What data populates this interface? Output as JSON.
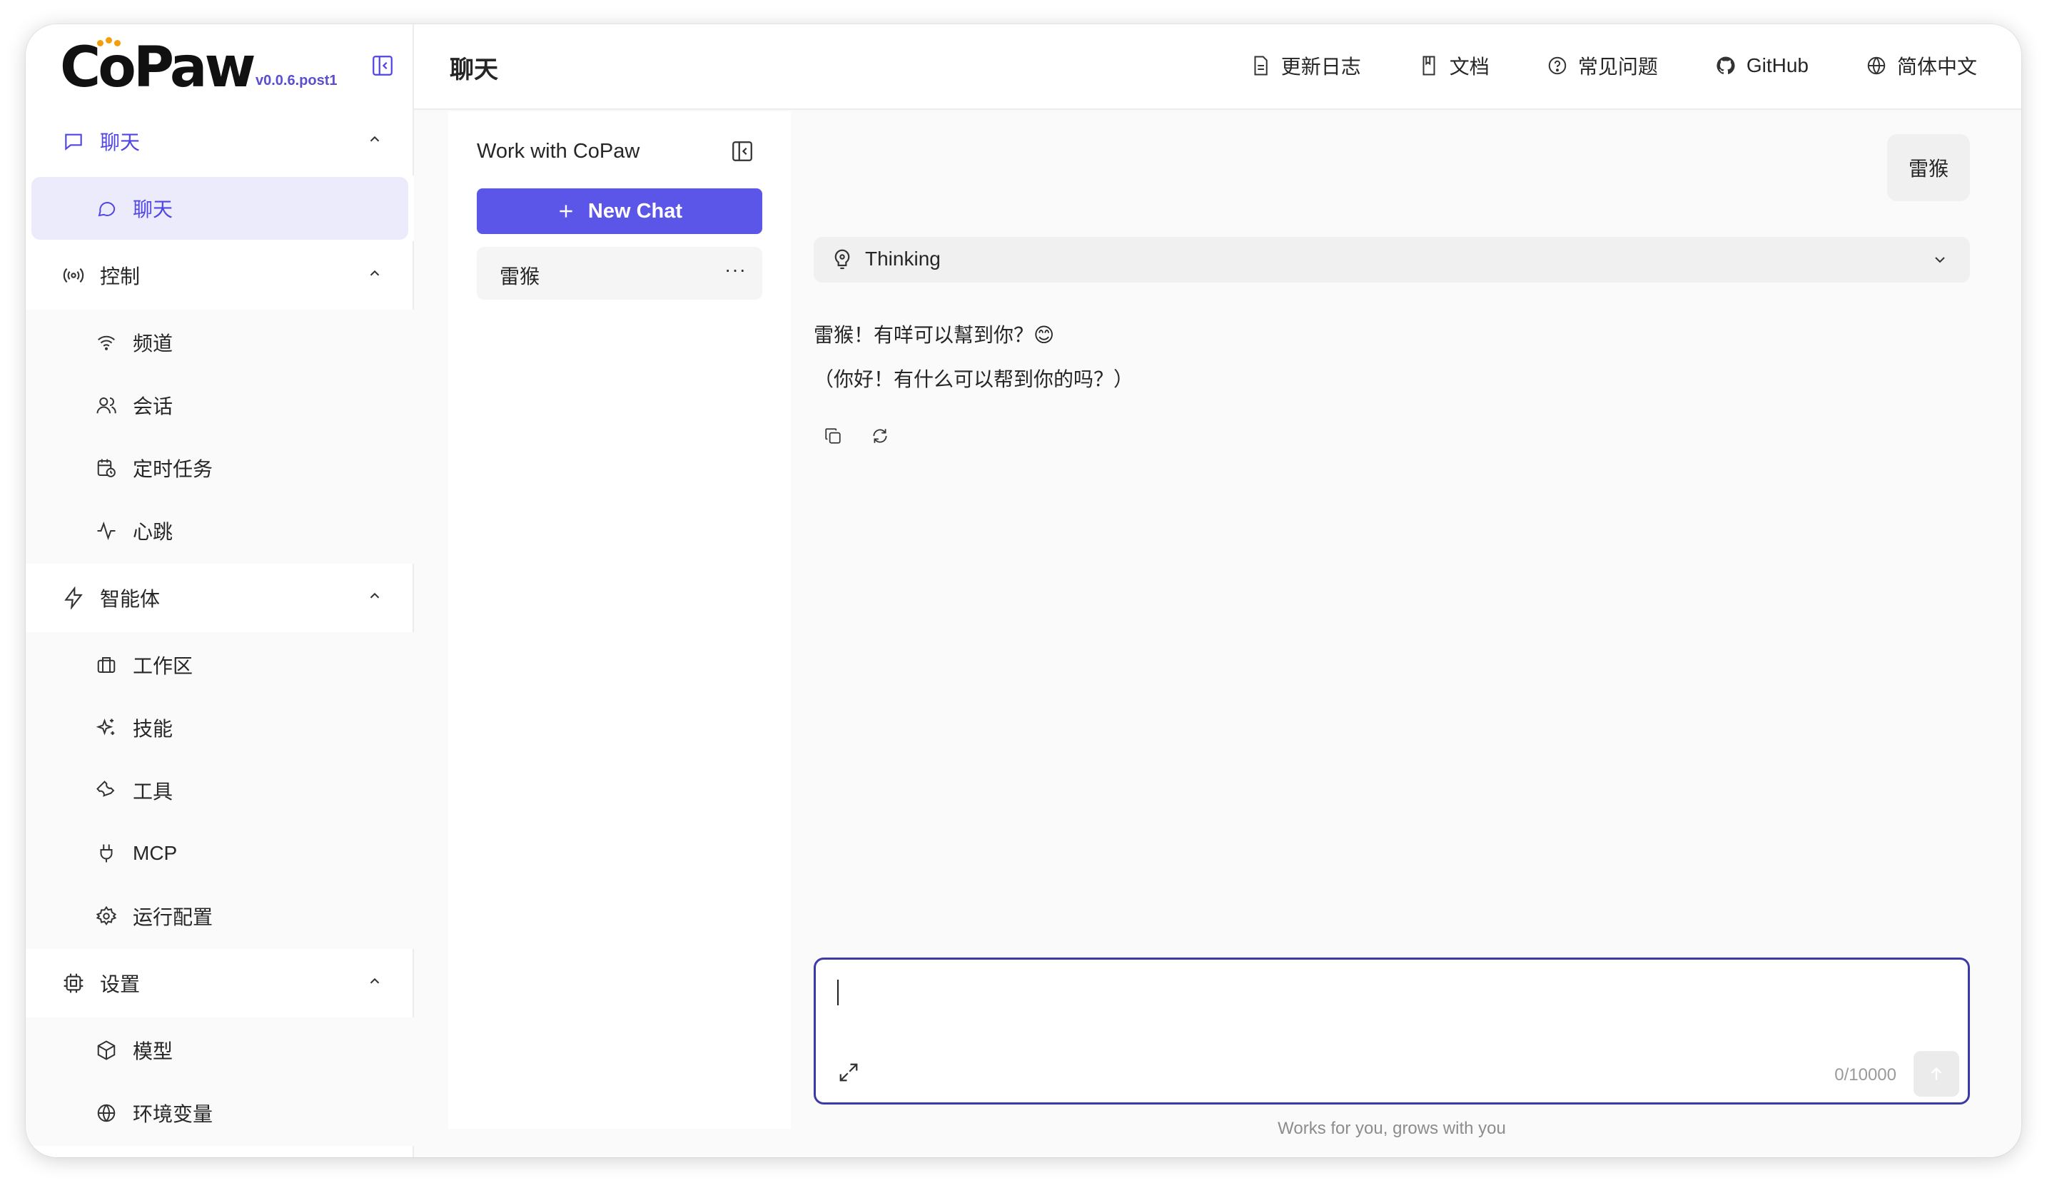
{
  "app": {
    "logo_text": "CoPaw",
    "version": "v0.0.6.post1",
    "brand_color": "#5b55e8",
    "accent_color": "#4f46e5"
  },
  "sidebar": {
    "groups": [
      {
        "label": "聊天",
        "icon": "message-square-icon",
        "expanded": true,
        "items": [
          {
            "label": "聊天",
            "icon": "message-circle-icon",
            "selected": true
          }
        ]
      },
      {
        "label": "控制",
        "icon": "broadcast-icon",
        "expanded": true,
        "items": [
          {
            "label": "频道",
            "icon": "wifi-icon"
          },
          {
            "label": "会话",
            "icon": "users-icon"
          },
          {
            "label": "定时任务",
            "icon": "calendar-clock-icon"
          },
          {
            "label": "心跳",
            "icon": "activity-icon"
          }
        ]
      },
      {
        "label": "智能体",
        "icon": "zap-icon",
        "expanded": true,
        "items": [
          {
            "label": "工作区",
            "icon": "briefcase-icon"
          },
          {
            "label": "技能",
            "icon": "sparkles-icon"
          },
          {
            "label": "工具",
            "icon": "wrench-icon"
          },
          {
            "label": "MCP",
            "icon": "plug-icon"
          },
          {
            "label": "运行配置",
            "icon": "settings-icon"
          }
        ]
      },
      {
        "label": "设置",
        "icon": "cpu-icon",
        "expanded": true,
        "items": [
          {
            "label": "模型",
            "icon": "box-icon"
          },
          {
            "label": "环境变量",
            "icon": "globe-icon"
          }
        ]
      }
    ]
  },
  "header": {
    "title": "聊天",
    "links": [
      {
        "label": "更新日志",
        "icon": "file-text-icon"
      },
      {
        "label": "文档",
        "icon": "book-icon"
      },
      {
        "label": "常见问题",
        "icon": "help-circle-icon"
      },
      {
        "label": "GitHub",
        "icon": "github-icon"
      },
      {
        "label": "简体中文",
        "icon": "globe-icon"
      }
    ]
  },
  "sessions": {
    "title": "Work with CoPaw",
    "new_chat_label": "New Chat",
    "items": [
      {
        "name": "雷猴",
        "more": "···"
      }
    ]
  },
  "chat": {
    "user_message": "雷猴",
    "thinking_label": "Thinking",
    "reply_line1": "雷猴！有咩可以幫到你？😊",
    "reply_line2": "（你好！有什么可以帮到你的吗？）",
    "input": {
      "value": "",
      "counter": "0/10000"
    },
    "footer": "Works for you, grows with you"
  }
}
